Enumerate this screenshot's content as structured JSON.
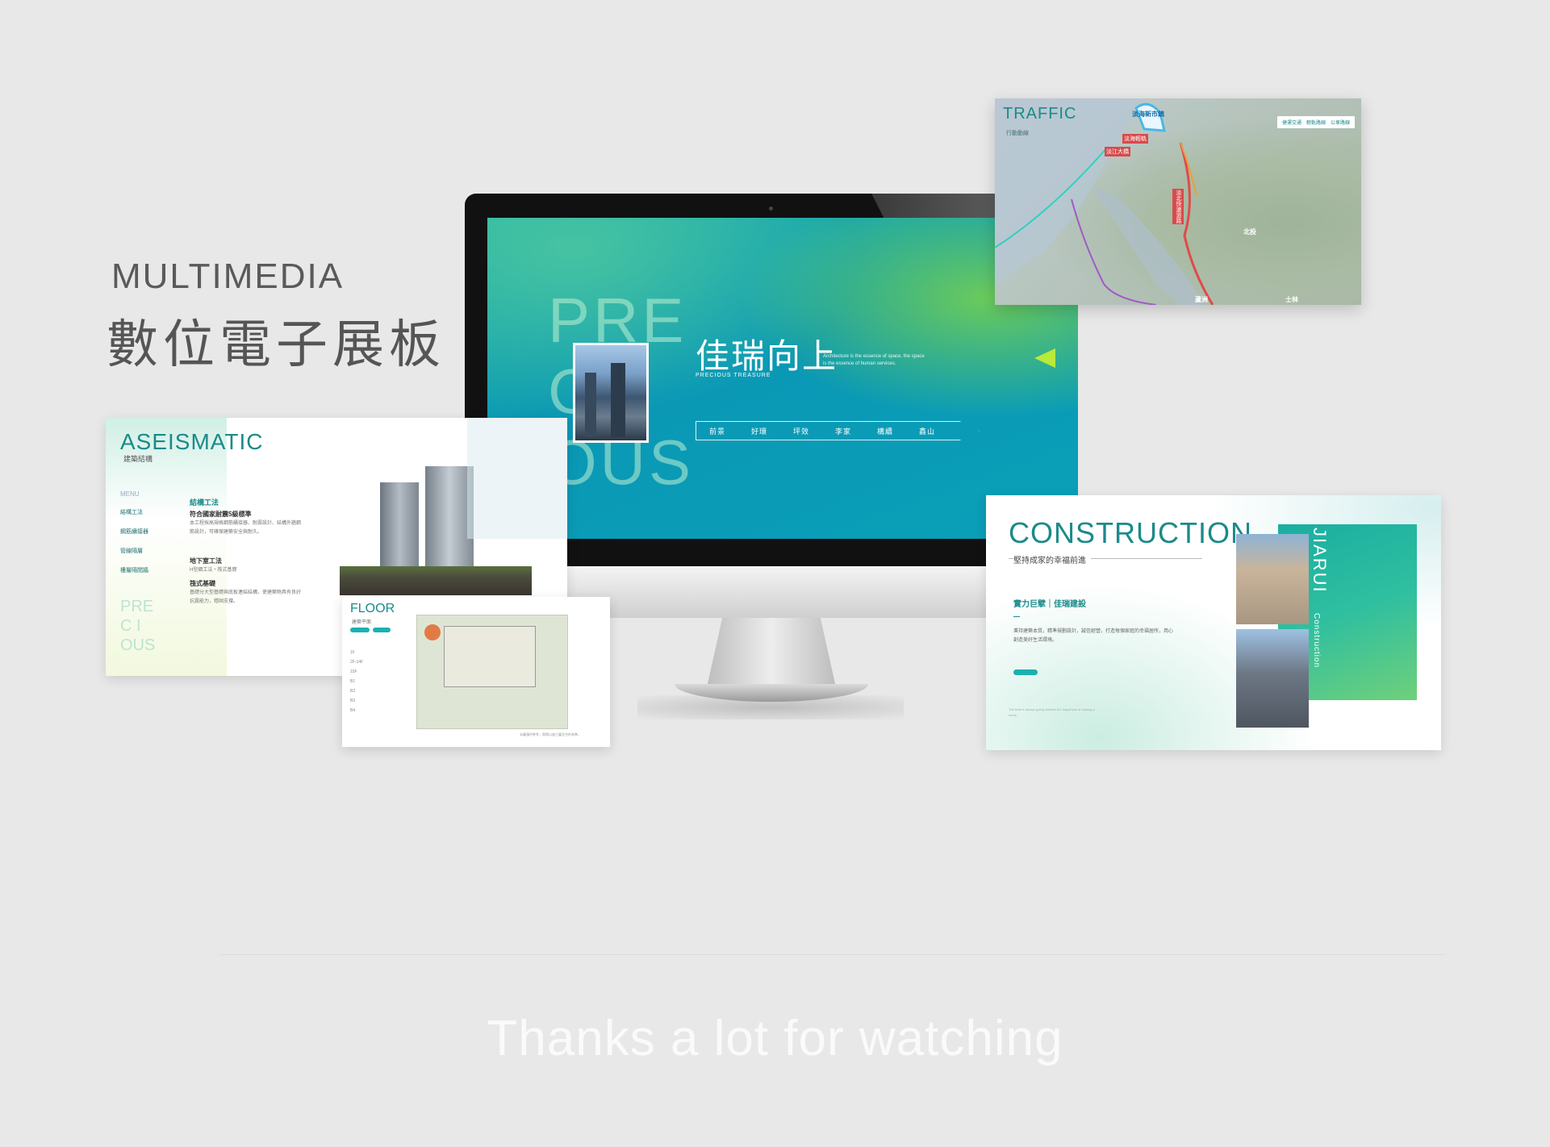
{
  "headline": {
    "en": "MULTIMEDIA",
    "zh": "數位電子展板"
  },
  "screen": {
    "pre_lines": [
      "PRE",
      "CI",
      "OUS"
    ],
    "title": "佳瑞向上",
    "brand": "PRECIOUS  TREASURE",
    "tagline": "Architecture is the essence of space, the space is the essence of human services.",
    "nav": [
      "前景",
      "好環",
      "坪效",
      "李家",
      "構續",
      "鑫山"
    ]
  },
  "traffic": {
    "title": "TRAFFIC",
    "subtitle": "行動動線",
    "tabs": [
      "捷運交通",
      "輕軌路線",
      "公車路線"
    ],
    "labels": {
      "new_city": "淡海新市鎮",
      "beitou": "北投",
      "luzhou": "蘆洲",
      "shilin": "士林"
    },
    "tags": [
      "淡海輕軌",
      "淡江大橋",
      "淡北快速道路"
    ]
  },
  "aseismatic": {
    "title": "ASEISMATIC",
    "subtitle": "建築結構",
    "menu_label": "MENU",
    "menu": [
      "結構工法",
      "鋼筋續接器",
      "管線隔層",
      "樓層隔間牆"
    ],
    "pre": [
      "PRE",
      "C  I",
      "OUS"
    ],
    "heading": "結構工法",
    "sub1": "符合國家耐震5級標準",
    "body1": "本工程採高規格鋼筋續接器、耐震設計、結構外牆鋼筋設計，可確保建築安全與耐久。",
    "sub2": "地下室工法",
    "body2": "H型鋼工法・筏式基礎",
    "sub3": "筏式基礎",
    "body3": "基礎分大型基礎與底板連結結構，使建築物具有良好抗震能力，穩固支撐。"
  },
  "floor": {
    "title": "FLOOR",
    "subtitle": "建築平面",
    "items": [
      "1F",
      "2F-14F",
      "15F",
      "B1",
      "B2",
      "B3",
      "B4"
    ],
    "note": "本圖僅供參考，實際以施工圖及合約為準。"
  },
  "construction": {
    "title": "CONSTRUCTION",
    "subtitle": "堅持成家的幸福前進",
    "heading": "實力巨擘｜佳瑞建設",
    "body": "秉持建築本質，精準規劃設計，誠信經營，打造每個家庭的幸福居所，用心創造美好生活環境。",
    "footnote": "The best is always going towards the happiness of making a home.",
    "vertical": "JIARUI",
    "vertical_small": "Construction"
  },
  "footer": {
    "text": "Thanks a lot for watching"
  },
  "colors": {
    "teal": "#1b8a8a",
    "background": "#e8e8e8",
    "accent_green": "#b8ea3a"
  }
}
